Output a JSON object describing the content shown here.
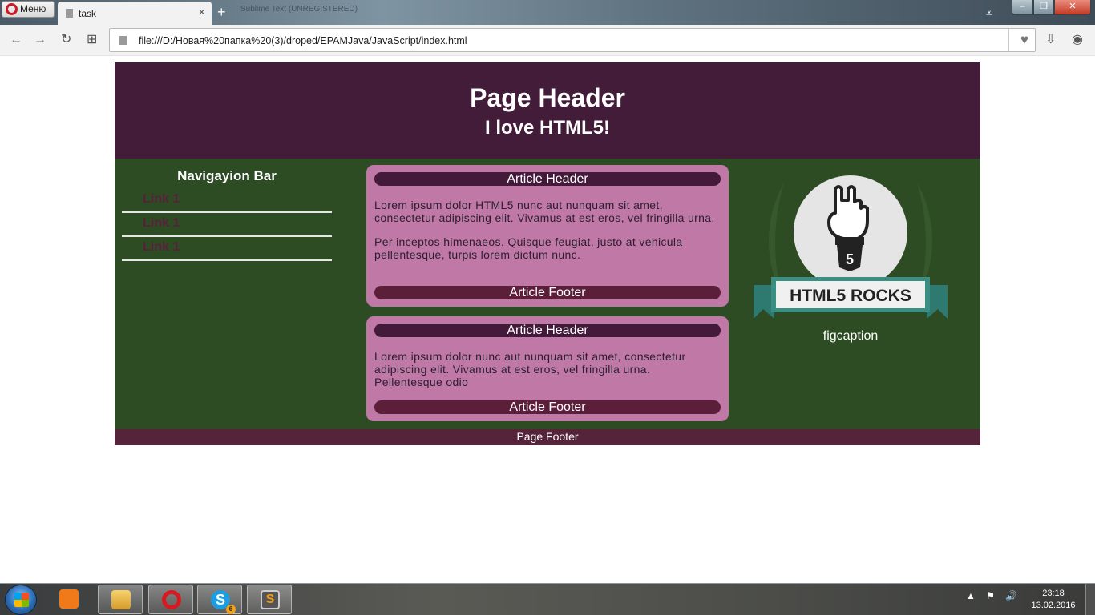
{
  "browser": {
    "menu_label": "Меню",
    "tab_title": "task",
    "tab_close": "×",
    "new_tab": "+",
    "background_tab": "Sublime Text (UNREGISTERED)",
    "url": "file:///D:/Новая%20папка%20(3)/droped/EPAMJava/JavaScript/index.html",
    "icons": {
      "back": "←",
      "forward": "→",
      "reload": "↻",
      "speed_dial": "⊞",
      "heart": "♥",
      "download": "⇩",
      "profile": "◉",
      "tab_menu": "⩡",
      "minimize": "–",
      "maximize": "❐",
      "close": "✕"
    }
  },
  "page": {
    "header_title": "Page Header",
    "header_subtitle": "I love HTML5!",
    "nav_title": "Navigayion Bar",
    "nav_links": [
      "Link 1",
      "Link 1",
      "Link 1"
    ],
    "articles": [
      {
        "header": "Article Header",
        "paragraphs": [
          "Lorem ipsum dolor HTML5 nunc aut nunquam sit amet, consectetur adipiscing elit. Vivamus at est eros, vel fringilla urna.",
          "Per inceptos himenaeos. Quisque feugiat, justo at vehicula pellentesque, turpis lorem dictum nunc."
        ],
        "footer": "Article Footer"
      },
      {
        "header": "Article Header",
        "paragraphs": [
          "Lorem ipsum dolor nunc aut nunquam sit amet, consectetur adipiscing elit. Vivamus at est eros, vel fringilla urna. Pellentesque odio"
        ],
        "footer": "Article Footer"
      }
    ],
    "figure_badge_text": "HTML5 ROCKS",
    "figure_shield_text": "5",
    "figcaption": "figcaption",
    "footer": "Page Footer",
    "colors": {
      "header_bg": "#421c39",
      "main_bg": "#2d4c24",
      "article_bg": "#c078a6",
      "footer_bg": "#55233a",
      "link_color": "#5a1f3a"
    }
  },
  "taskbar": {
    "skype_badge": "6",
    "sublime_glyph": "S",
    "skype_glyph": "S",
    "clock_time": "23:18",
    "clock_date": "13.02.2016",
    "tray_icons": [
      "▲",
      "⚑",
      "🔊"
    ]
  }
}
